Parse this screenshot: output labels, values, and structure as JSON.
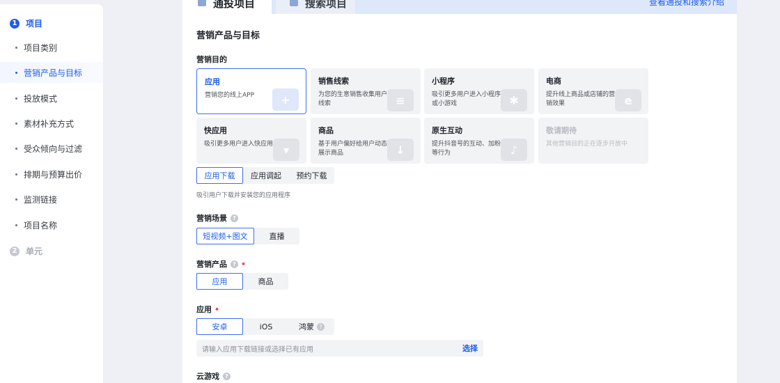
{
  "tabs": [
    {
      "label": "通投项目"
    },
    {
      "label": "搜索项目"
    }
  ],
  "top_link": "查看通投和搜索介绍",
  "sidebar": {
    "step1": {
      "num": "1",
      "label": "项目"
    },
    "items": [
      {
        "label": "项目类别"
      },
      {
        "label": "营销产品与目标"
      },
      {
        "label": "投放模式"
      },
      {
        "label": "素材补充方式"
      },
      {
        "label": "受众倾向与过滤"
      },
      {
        "label": "排期与预算出价"
      },
      {
        "label": "监测链接"
      },
      {
        "label": "项目名称"
      }
    ],
    "step2": {
      "num": "2",
      "label": "单元"
    }
  },
  "section_title": "营销产品与目标",
  "marketing_goal": {
    "label": "营销目的",
    "cards": [
      {
        "title": "应用",
        "desc": "营销您的线上APP",
        "icon": "plus-icon"
      },
      {
        "title": "销售线索",
        "desc": "为您的生意销售收集用户线索",
        "icon": "form-icon"
      },
      {
        "title": "小程序",
        "desc": "吸引更多用户进入小程序或小游戏",
        "icon": "miniprogram-icon"
      },
      {
        "title": "电商",
        "desc": "提升线上商品或店铺的营销效果",
        "icon": "e-icon"
      },
      {
        "title": "快应用",
        "desc": "吸引更多用户进入快应用",
        "icon": "quickapp-icon"
      },
      {
        "title": "商品",
        "desc": "基于用户偏好给用户动态展示商品",
        "icon": "cart-icon"
      },
      {
        "title": "原生互动",
        "desc": "提升抖音号的互动、加粉等行为",
        "icon": "douyin-icon"
      },
      {
        "title": "敬请期待",
        "desc": "其他营销目的正在逐步开放中",
        "icon": ""
      }
    ],
    "sub_options": [
      "应用下载",
      "应用调起",
      "预约下载"
    ],
    "hint": "吸引用户下载并安装您的应用程序"
  },
  "scene": {
    "label": "营销场景",
    "options": [
      "短视频+图文",
      "直播"
    ]
  },
  "product": {
    "label": "营销产品",
    "required": "•",
    "options": [
      "应用",
      "商品"
    ]
  },
  "app": {
    "label": "应用",
    "required": "•",
    "options": [
      "安卓",
      "iOS",
      "鸿蒙"
    ],
    "input_placeholder": "请输入应用下载链接或选择已有应用",
    "choose": "选择"
  },
  "cloud_game": {
    "label": "云游戏"
  },
  "help_icon": "?",
  "colors": {
    "accent": "#1d5cf0",
    "required": "#f53f3f"
  }
}
